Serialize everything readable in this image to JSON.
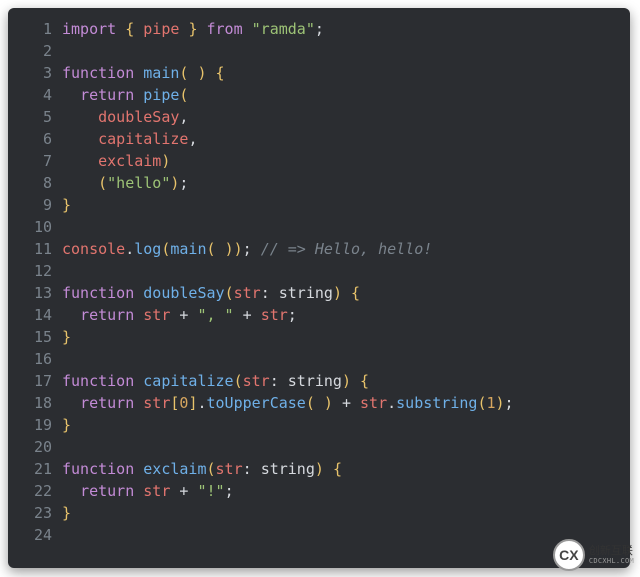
{
  "lineNumbers": [
    "1",
    "2",
    "3",
    "4",
    "5",
    "6",
    "7",
    "8",
    "9",
    "10",
    "11",
    "12",
    "13",
    "14",
    "15",
    "16",
    "17",
    "18",
    "19",
    "20",
    "21",
    "22",
    "23",
    "24"
  ],
  "code": {
    "lines": [
      [
        [
          "keyword",
          "import"
        ],
        [
          "punct",
          " "
        ],
        [
          "brace",
          "{"
        ],
        [
          "punct",
          " "
        ],
        [
          "ident",
          "pipe"
        ],
        [
          "punct",
          " "
        ],
        [
          "brace",
          "}"
        ],
        [
          "punct",
          " "
        ],
        [
          "keyword",
          "from"
        ],
        [
          "punct",
          " "
        ],
        [
          "string",
          "\"ramda\""
        ],
        [
          "punct",
          ";"
        ]
      ],
      [],
      [
        [
          "keyword",
          "function"
        ],
        [
          "punct",
          " "
        ],
        [
          "func",
          "main"
        ],
        [
          "brace",
          "("
        ],
        [
          "punct",
          " "
        ],
        [
          "brace",
          ")"
        ],
        [
          "punct",
          " "
        ],
        [
          "brace",
          "{"
        ]
      ],
      [
        [
          "punct",
          "  "
        ],
        [
          "keyword",
          "return"
        ],
        [
          "punct",
          " "
        ],
        [
          "call",
          "pipe"
        ],
        [
          "brace",
          "("
        ]
      ],
      [
        [
          "punct",
          "    "
        ],
        [
          "ident",
          "doubleSay"
        ],
        [
          "punct",
          ","
        ]
      ],
      [
        [
          "punct",
          "    "
        ],
        [
          "ident",
          "capitalize"
        ],
        [
          "punct",
          ","
        ]
      ],
      [
        [
          "punct",
          "    "
        ],
        [
          "ident",
          "exclaim"
        ],
        [
          "brace",
          ")"
        ]
      ],
      [
        [
          "punct",
          "    "
        ],
        [
          "brace",
          "("
        ],
        [
          "string",
          "\"hello\""
        ],
        [
          "brace",
          ")"
        ],
        [
          "punct",
          ";"
        ]
      ],
      [
        [
          "brace",
          "}"
        ]
      ],
      [],
      [
        [
          "ident",
          "console"
        ],
        [
          "punct",
          "."
        ],
        [
          "call",
          "log"
        ],
        [
          "brace",
          "("
        ],
        [
          "call",
          "main"
        ],
        [
          "brace",
          "("
        ],
        [
          "punct",
          " "
        ],
        [
          "brace",
          ")"
        ],
        [
          "brace",
          ")"
        ],
        [
          "punct",
          "; "
        ],
        [
          "comment",
          "// => Hello, hello!"
        ]
      ],
      [],
      [
        [
          "keyword",
          "function"
        ],
        [
          "punct",
          " "
        ],
        [
          "func",
          "doubleSay"
        ],
        [
          "brace",
          "("
        ],
        [
          "ident",
          "str"
        ],
        [
          "punct",
          ": "
        ],
        [
          "type",
          "string"
        ],
        [
          "brace",
          ")"
        ],
        [
          "punct",
          " "
        ],
        [
          "brace",
          "{"
        ]
      ],
      [
        [
          "punct",
          "  "
        ],
        [
          "keyword",
          "return"
        ],
        [
          "punct",
          " "
        ],
        [
          "ident",
          "str"
        ],
        [
          "punct",
          " + "
        ],
        [
          "string",
          "\", \""
        ],
        [
          "punct",
          " + "
        ],
        [
          "ident",
          "str"
        ],
        [
          "punct",
          ";"
        ]
      ],
      [
        [
          "brace",
          "}"
        ]
      ],
      [],
      [
        [
          "keyword",
          "function"
        ],
        [
          "punct",
          " "
        ],
        [
          "func",
          "capitalize"
        ],
        [
          "brace",
          "("
        ],
        [
          "ident",
          "str"
        ],
        [
          "punct",
          ": "
        ],
        [
          "type",
          "string"
        ],
        [
          "brace",
          ")"
        ],
        [
          "punct",
          " "
        ],
        [
          "brace",
          "{"
        ]
      ],
      [
        [
          "punct",
          "  "
        ],
        [
          "keyword",
          "return"
        ],
        [
          "punct",
          " "
        ],
        [
          "ident",
          "str"
        ],
        [
          "brace",
          "["
        ],
        [
          "num",
          "0"
        ],
        [
          "brace",
          "]"
        ],
        [
          "punct",
          "."
        ],
        [
          "call",
          "toUpperCase"
        ],
        [
          "brace",
          "("
        ],
        [
          "punct",
          " "
        ],
        [
          "brace",
          ")"
        ],
        [
          "punct",
          " + "
        ],
        [
          "ident",
          "str"
        ],
        [
          "punct",
          "."
        ],
        [
          "call",
          "substring"
        ],
        [
          "brace",
          "("
        ],
        [
          "num",
          "1"
        ],
        [
          "brace",
          ")"
        ],
        [
          "punct",
          ";"
        ]
      ],
      [
        [
          "brace",
          "}"
        ]
      ],
      [],
      [
        [
          "keyword",
          "function"
        ],
        [
          "punct",
          " "
        ],
        [
          "func",
          "exclaim"
        ],
        [
          "brace",
          "("
        ],
        [
          "ident",
          "str"
        ],
        [
          "punct",
          ": "
        ],
        [
          "type",
          "string"
        ],
        [
          "brace",
          ")"
        ],
        [
          "punct",
          " "
        ],
        [
          "brace",
          "{"
        ]
      ],
      [
        [
          "punct",
          "  "
        ],
        [
          "keyword",
          "return"
        ],
        [
          "punct",
          " "
        ],
        [
          "ident",
          "str"
        ],
        [
          "punct",
          " + "
        ],
        [
          "string",
          "\"!\""
        ],
        [
          "punct",
          ";"
        ]
      ],
      [
        [
          "brace",
          "}"
        ]
      ],
      []
    ]
  },
  "watermark": {
    "badge": "CX",
    "text": "创新互联",
    "sub": "CDCXHL.COM"
  }
}
